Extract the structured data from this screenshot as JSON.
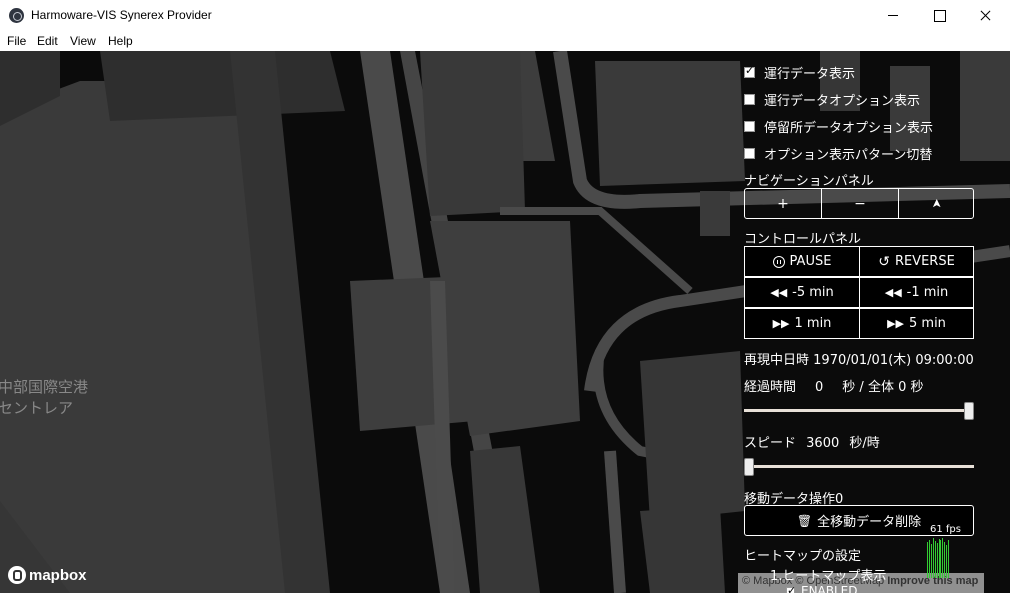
{
  "window": {
    "title": "Harmoware-VIS Synerex Provider"
  },
  "menu": {
    "items": [
      "File",
      "Edit",
      "View",
      "Help"
    ]
  },
  "map": {
    "labels": [
      "中部国際空港",
      "セントレア"
    ],
    "logo_text": "mapbox",
    "attribution": {
      "mapbox": "© Mapbox",
      "osm": "© OpenStreetMap",
      "improve": "Improve this map"
    }
  },
  "panel": {
    "checkboxes": [
      {
        "label": "運行データ表示",
        "checked": true
      },
      {
        "label": "運行データオプション表示",
        "checked": false
      },
      {
        "label": "停留所データオプション表示",
        "checked": false
      },
      {
        "label": "オプション表示パターン切替",
        "checked": false
      }
    ],
    "navigation": {
      "title": "ナビゲーションパネル",
      "zoom_in": "+",
      "zoom_out": "−",
      "compass": "➤"
    },
    "control": {
      "title": "コントロールパネル",
      "pause_label": "PAUSE",
      "reverse_label": "REVERSE",
      "back5_label": "-5 min",
      "back1_label": "-1 min",
      "fwd1_label": "1 min",
      "fwd5_label": "5 min"
    },
    "playback": {
      "label": "再現中日時",
      "datetime": "1970/01/01(木) 09:00:00"
    },
    "elapsed": {
      "label": "経過時間",
      "value": "0",
      "unit_label": "秒 / 全体 0 秒",
      "slider_position": 1.0
    },
    "speed": {
      "label": "スピード",
      "value": "3600",
      "unit": "秒/時",
      "slider_position": 0.0
    },
    "move_data": {
      "label": "移動データ操作0",
      "delete_label": "全移動データ削除"
    },
    "fps": {
      "text": "61 fps"
    },
    "heatmap": {
      "title": "ヒートマップの設定",
      "item": "1.ヒートマップ表示",
      "enabled_label": "ENABLED"
    }
  },
  "colors": {
    "map_background": "#0b0b0b",
    "building": "#3a3a3a",
    "road": "#545454",
    "fps_graph": "#33cc33"
  }
}
